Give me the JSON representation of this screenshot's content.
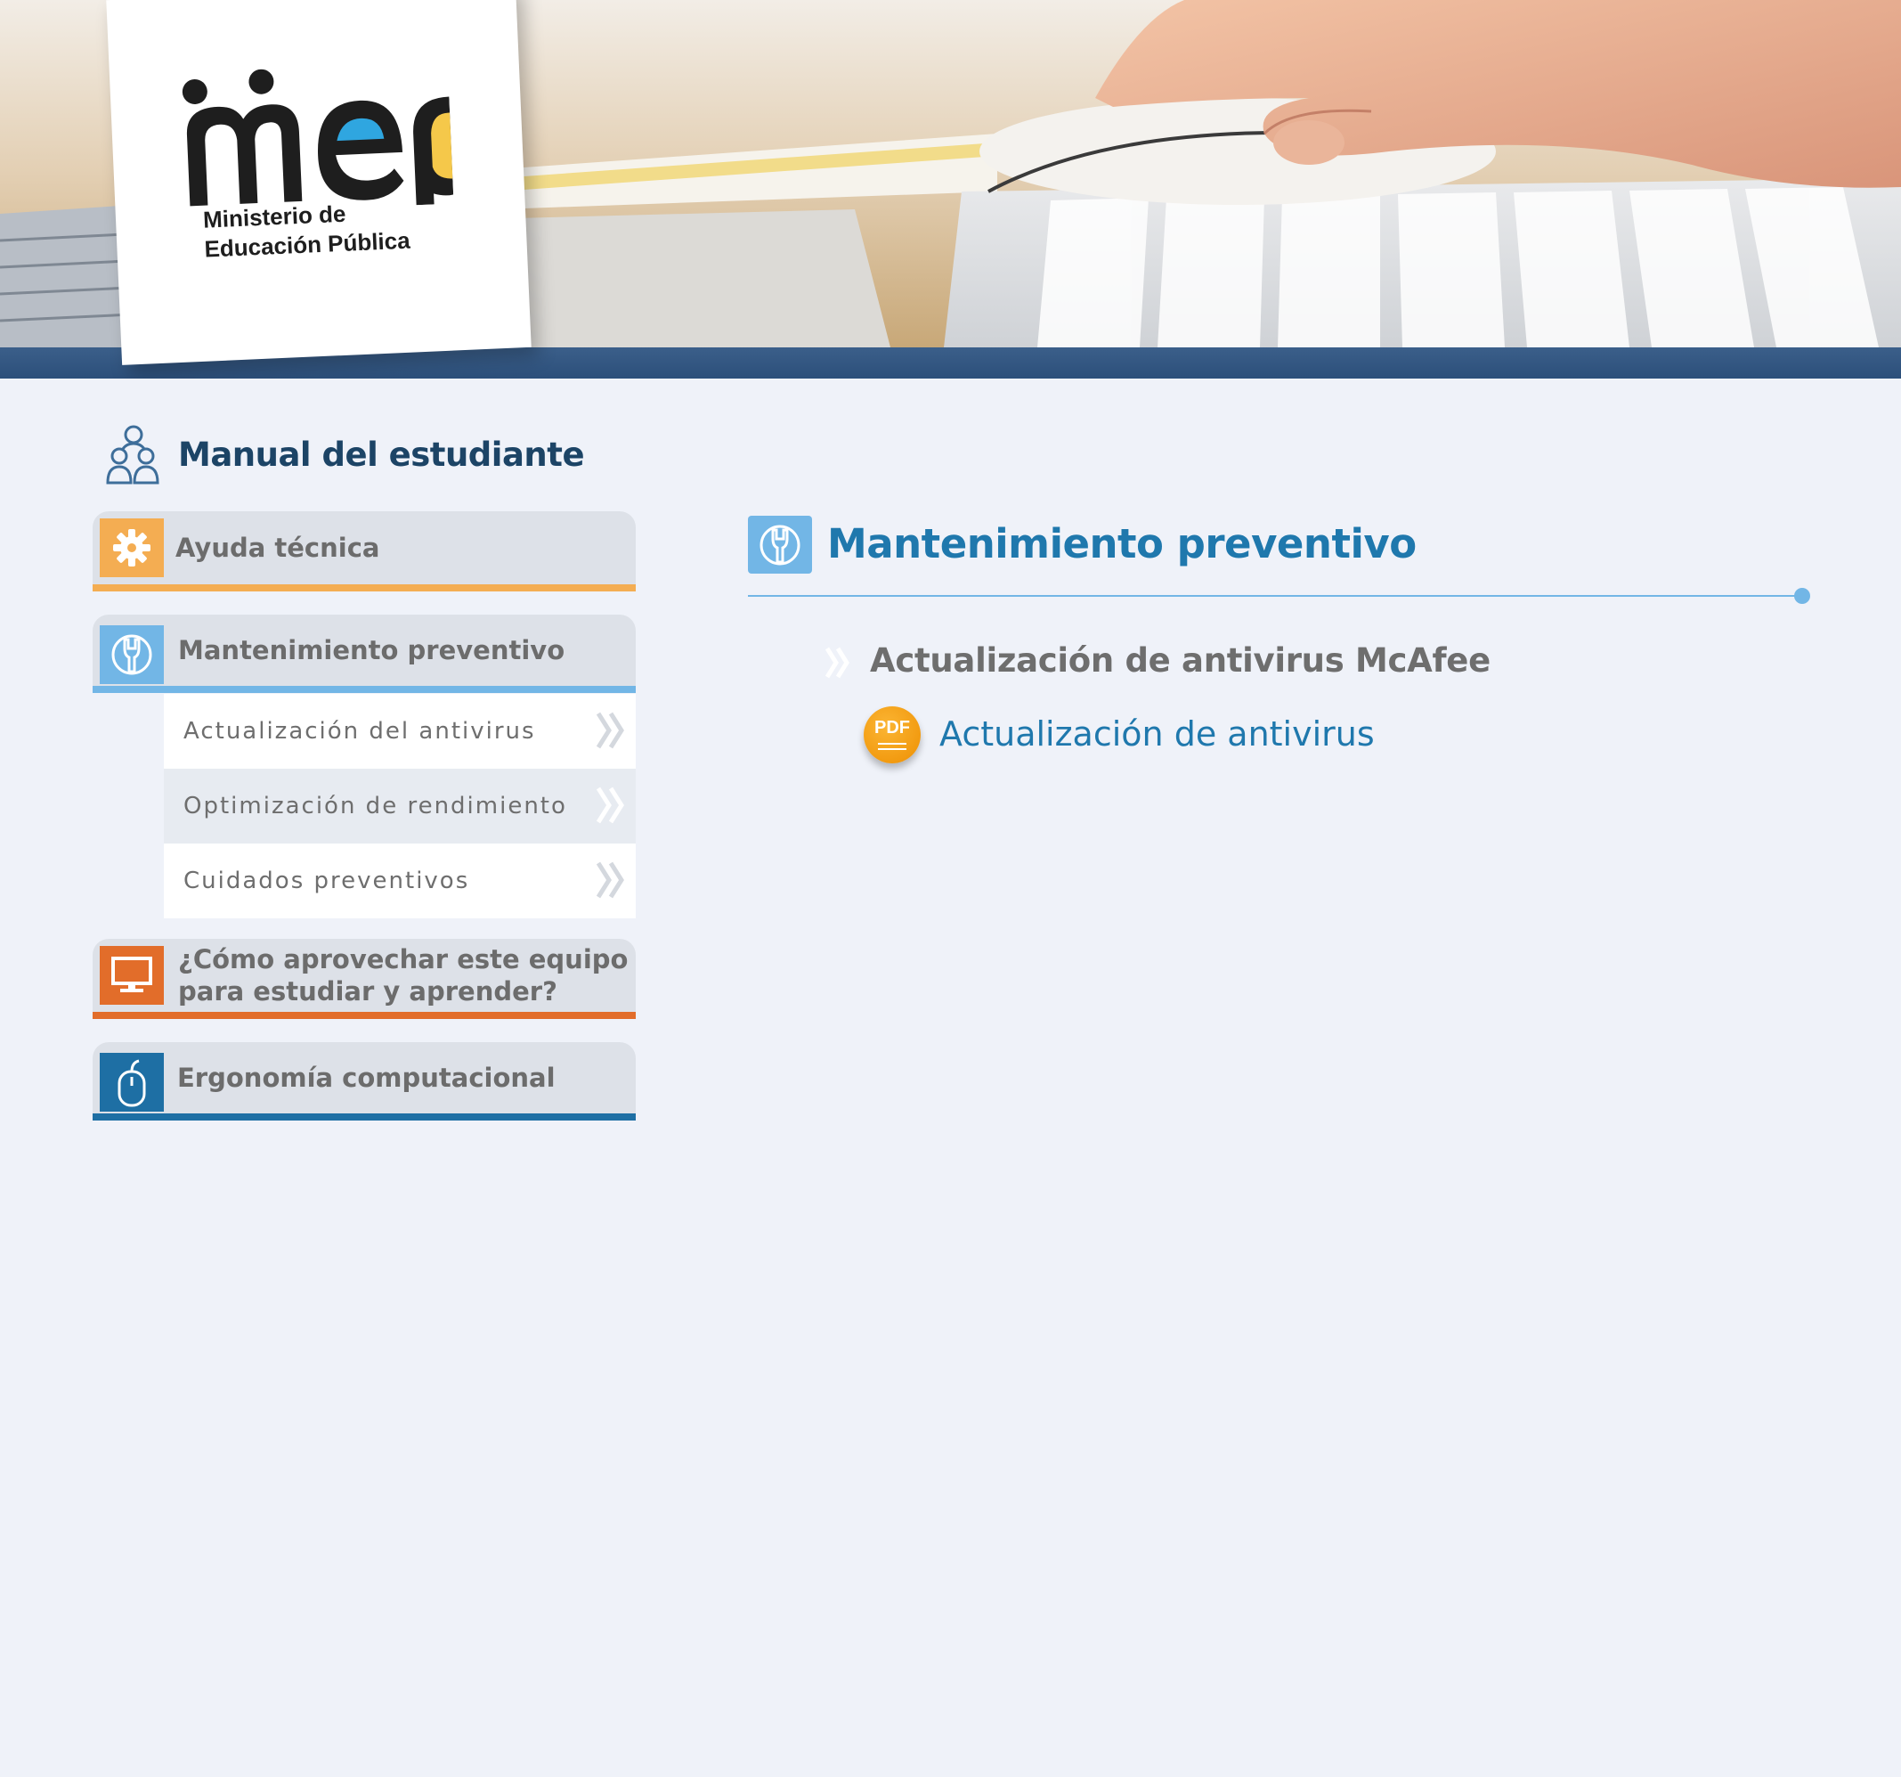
{
  "logo": {
    "brand": "mep",
    "line1": "Ministerio de",
    "line2": "Educación Pública"
  },
  "sidebar": {
    "title": "Manual del estudiante",
    "menu": [
      {
        "label": "Ayuda técnica",
        "icon": "gear-icon",
        "color": "#f4ad52"
      },
      {
        "label": "Mantenimiento preventivo",
        "icon": "wrench-icon",
        "color": "#72b6e6"
      },
      {
        "label_line1": "¿Cómo aprovechar este equipo",
        "label_line2": "para estudiar y aprender?",
        "icon": "monitor-icon",
        "color": "#e26d2a"
      },
      {
        "label": "Ergonomía computacional",
        "icon": "mouse-icon",
        "color": "#1e6fa4"
      }
    ],
    "submenu": [
      {
        "label": "Actualización del antivirus"
      },
      {
        "label": "Optimización de rendimiento"
      },
      {
        "label": "Cuidados preventivos"
      }
    ]
  },
  "main": {
    "section_title": "Mantenimiento preventivo",
    "topic_title": "Actualización de antivirus McAfee",
    "pdf_badge": "PDF",
    "pdf_link": "Actualización de antivirus"
  },
  "colors": {
    "accent_blue": "#72b6e6",
    "title_blue": "#1f78ad",
    "header_band": "#2c4f7a",
    "orange": "#f4ad52",
    "pdf_orange": "#f29b11"
  }
}
